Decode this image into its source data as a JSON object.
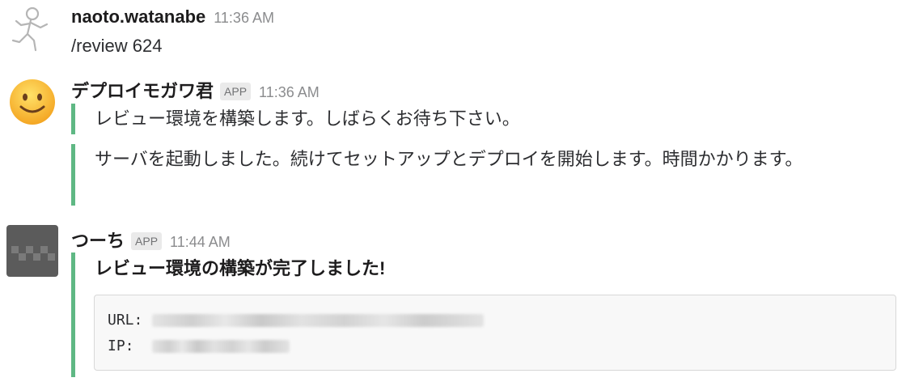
{
  "messages": [
    {
      "sender": "naoto.watanabe",
      "time": "11:36 AM",
      "text": "/review 624",
      "avatar_icon": "running-person-icon"
    },
    {
      "sender": "デプロイモガワ君",
      "badge": "APP",
      "time": "11:36 AM",
      "avatar_icon": "smiley-emoji-icon",
      "attachments": [
        "レビュー環境を構築します。しばらくお待ち下さい。",
        "サーバを起動しました。続けてセットアップとデプロイを開始します。時間かかります。"
      ]
    },
    {
      "sender": "つーち",
      "badge": "APP",
      "time": "11:44 AM",
      "avatar_icon": "checker-pattern-icon",
      "attachment_title": "レビュー環境の構築が完了しました!",
      "code": {
        "url_label": "URL:",
        "ip_label": "IP:"
      }
    }
  ],
  "colors": {
    "attachment_border": "#5fb884",
    "badge_bg": "#eaeaea",
    "timestamp": "#8b8c8e"
  }
}
